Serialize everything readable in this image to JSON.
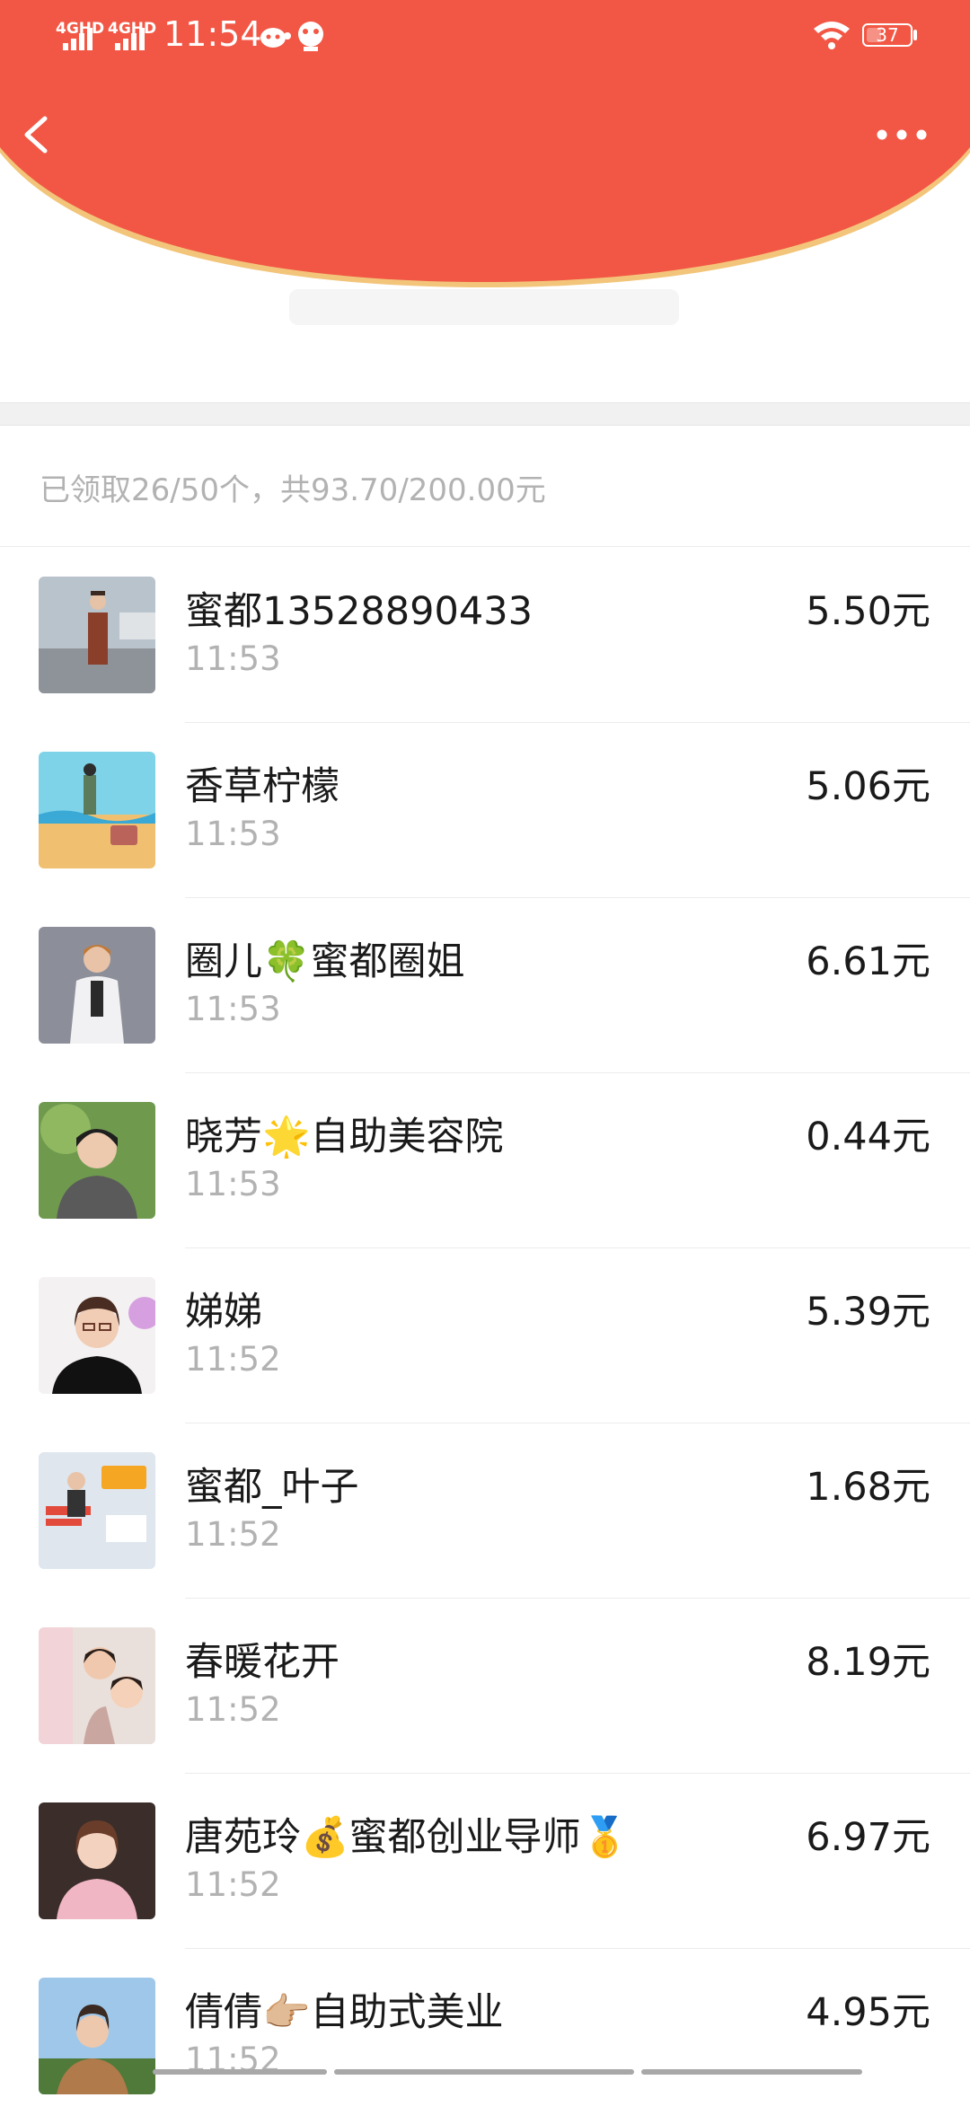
{
  "status_bar": {
    "network_1": "4GHD",
    "network_2": "4GHD",
    "time": "11:54",
    "battery": "37",
    "icons": [
      "signal-icon",
      "signal-icon",
      "notification-cow-icon",
      "notification-sticker-icon",
      "wifi-icon",
      "battery-icon"
    ]
  },
  "nav": {
    "back_icon": "chevron-left-icon",
    "more_icon": "more-dots-icon"
  },
  "colors": {
    "header_red": "#f25745",
    "header_gold_edge": "#f2c57a"
  },
  "summary": "已领取26/50个，共93.70/200.00元",
  "recipients": [
    {
      "name": "蜜都13528890433",
      "time": "11:53",
      "amount": "5.50元",
      "avatar": "avatar-photo"
    },
    {
      "name": "香草柠檬",
      "time": "11:53",
      "amount": "5.06元",
      "avatar": "avatar-photo"
    },
    {
      "name": "圈儿🍀蜜都圈姐",
      "time": "11:53",
      "amount": "6.61元",
      "avatar": "avatar-photo"
    },
    {
      "name": "晓芳🌟自助美容院",
      "time": "11:53",
      "amount": "0.44元",
      "avatar": "avatar-photo"
    },
    {
      "name": "娣娣",
      "time": "11:52",
      "amount": "5.39元",
      "avatar": "avatar-photo"
    },
    {
      "name": "蜜都_叶子",
      "time": "11:52",
      "amount": "1.68元",
      "avatar": "avatar-photo"
    },
    {
      "name": "春暖花开",
      "time": "11:52",
      "amount": "8.19元",
      "avatar": "avatar-photo"
    },
    {
      "name": "唐苑玲💰蜜都创业导师🥇",
      "time": "11:52",
      "amount": "6.97元",
      "avatar": "avatar-photo"
    },
    {
      "name": "倩倩👉🏼自助式美业",
      "time": "11:52",
      "amount": "4.95元",
      "avatar": "avatar-photo"
    }
  ]
}
